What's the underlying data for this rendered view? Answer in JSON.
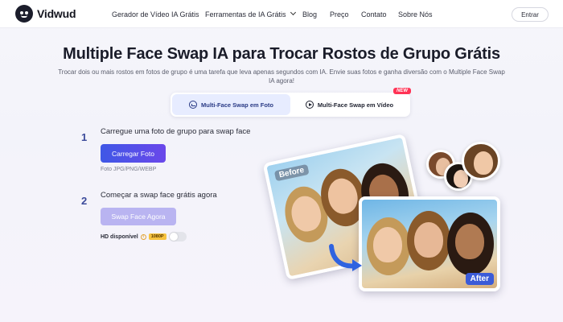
{
  "brand": {
    "name": "Vidwud"
  },
  "nav": {
    "items": [
      "Gerador de Vídeo IA Grátis",
      "Ferramentas de IA Grátis",
      "Blog",
      "Preço",
      "Contato",
      "Sobre Nós"
    ],
    "login": "Entrar"
  },
  "hero": {
    "title": "Multiple Face Swap IA para Trocar Rostos de Grupo Grátis",
    "subtitle": "Trocar dois ou mais rostos em fotos de grupo é uma tarefa que leva apenas segundos com IA. Envie suas fotos e ganha diversão com o Multiple Face Swap IA agora!"
  },
  "tabs": [
    {
      "label": "Multi-Face Swap em Foto",
      "active": true
    },
    {
      "label": "Multi-Face Swap em Vídeo",
      "active": false,
      "badge": "NEW"
    }
  ],
  "steps": [
    {
      "number": "1",
      "label": "Carregue uma foto de grupo para swap face",
      "button": "Carregar Foto",
      "note": "Foto JPG/PNG/WEBP"
    },
    {
      "number": "2",
      "label": "Começar a swap face grátis agora",
      "button": "Swap Face Agora"
    }
  ],
  "hd": {
    "label": "HD disponível",
    "badge": "1080P",
    "enabled": false
  },
  "illustration": {
    "before_tag": "Before",
    "after_tag": "After"
  },
  "colors": {
    "primary_start": "#3f58e6",
    "primary_end": "#6a47ea",
    "disabled": "#b9b4f1",
    "new_badge": "#ff3355",
    "hd_badge": "#f6c23e"
  }
}
